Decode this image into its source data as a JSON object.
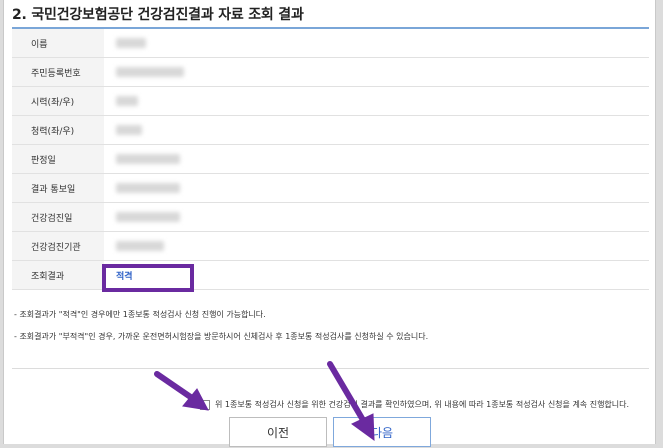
{
  "section": {
    "title": "2. 국민건강보험공단 건강검진결과 자료 조회 결과"
  },
  "rows": [
    {
      "label": "이름",
      "blur_w": 30
    },
    {
      "label": "주민등록번호",
      "blur_w": 68
    },
    {
      "label": "시력(좌/우)",
      "blur_w": 22
    },
    {
      "label": "청력(좌/우)",
      "blur_w": 26
    },
    {
      "label": "판정일",
      "blur_w": 64
    },
    {
      "label": "결과 통보일",
      "blur_w": 64
    },
    {
      "label": "건강검진일",
      "blur_w": 64
    },
    {
      "label": "건강검진기관",
      "blur_w": 48
    },
    {
      "label": "조회결과",
      "value": "적격"
    }
  ],
  "notes": [
    "조회결과가 \"적격\"인 경우에만 1종보통 적성검사 신청 진행이 가능합니다.",
    "조회결과가 \"부적격\"인 경우, 가까운 운전면허시험장을 방문하시어 신체검사 후 1종보통 적성검사를 신청하실 수 있습니다."
  ],
  "agreement": {
    "text": "위 1종보통 적성검사 신청을 위한 건강검진 결과를 확인하였으며, 위 내용에 따라 1종보통 적성검사 신청을 계속 진행합니다.",
    "checked": false
  },
  "buttons": {
    "prev_label": "이전",
    "next_label": "다음"
  },
  "colors": {
    "annotation": "#6a2aa0",
    "accent": "#2f62c7",
    "title_rule": "#7aa6d8"
  }
}
